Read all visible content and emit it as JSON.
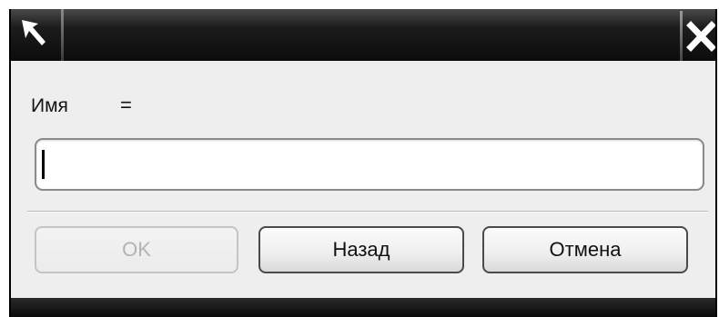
{
  "dialog": {
    "field_label": "Имя",
    "equals_sign": "=",
    "name_input": {
      "value": "",
      "placeholder": ""
    }
  },
  "buttons": {
    "ok_label": "OK",
    "back_label": "Назад",
    "cancel_label": "Отмена"
  },
  "icons": {
    "title_left": "pin-arrow-icon",
    "title_right": "close-icon"
  }
}
